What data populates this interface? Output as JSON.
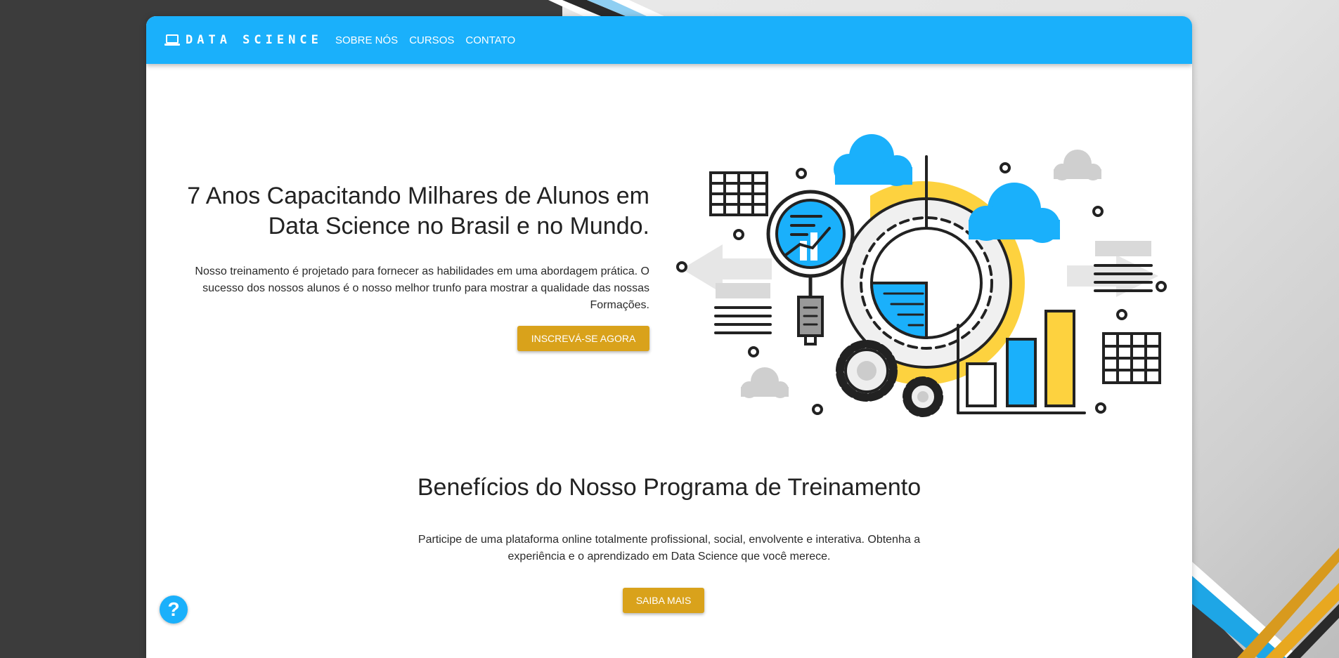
{
  "navbar": {
    "brand_icon": "laptop-icon",
    "brand": "DATA SCIENCE",
    "links": [
      "SOBRE NÓS",
      "CURSOS",
      "CONTATO"
    ],
    "color": "#1ab0fb"
  },
  "hero": {
    "title": "7 Anos Capacitando Milhares de Alunos em Data Science no Brasil e no Mundo.",
    "description": "Nosso treinamento é projetado para fornecer as habilidades em uma abordagem prática. O sucesso dos nossos alunos é o nosso melhor trunfo para mostrar a qualidade das nossas Formações.",
    "cta_label": "INSCREVÁ-SE AGORA",
    "cta_color": "#d9a21b"
  },
  "benefits": {
    "title": "Benefícios do Nosso Programa de Treinamento",
    "description": "Participe de uma plataforma online totalmente profissional, social, envolvente e interativa. Obtenha a experiência e o aprendizado em Data Science que você merece.",
    "cta_label": "SAIBA MAIS"
  },
  "help": {
    "icon": "question-icon",
    "label": "?"
  }
}
